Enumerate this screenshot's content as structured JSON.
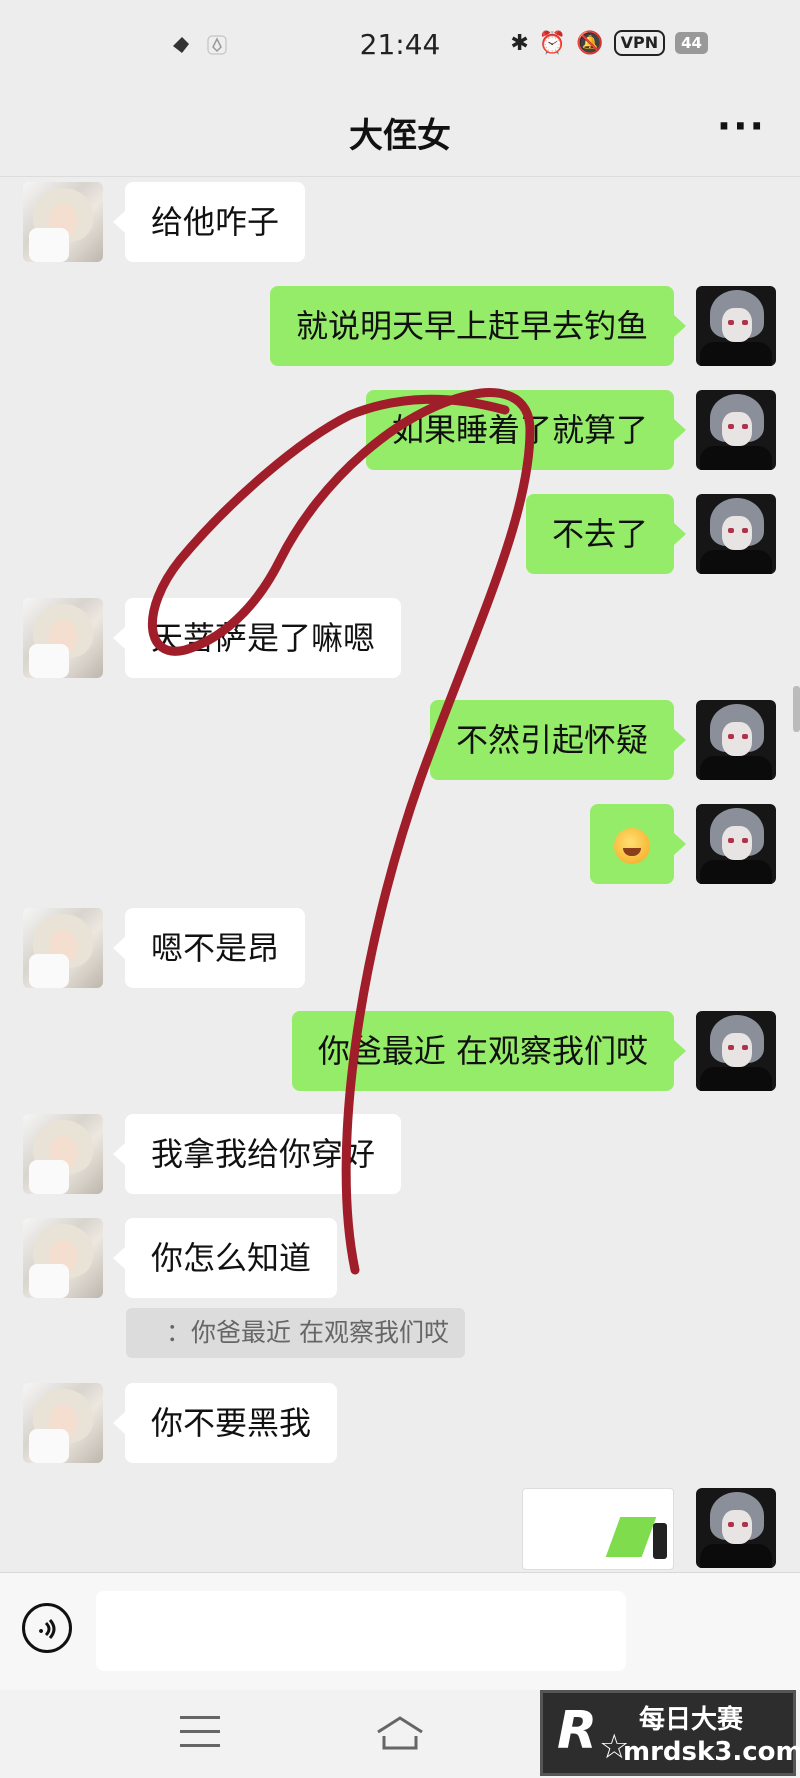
{
  "status_bar": {
    "time": "21:44",
    "vpn": "VPN",
    "battery": "44"
  },
  "header": {
    "title": "大侄女",
    "more": "···"
  },
  "messages": [
    {
      "side": "in",
      "text": "给他咋子"
    },
    {
      "side": "out",
      "text": "就说明天早上赶早去钓鱼"
    },
    {
      "side": "out",
      "text": "如果睡着了就算了"
    },
    {
      "side": "out",
      "text": "不去了"
    },
    {
      "side": "in",
      "text": "天菩萨是了嘛嗯"
    },
    {
      "side": "out",
      "text": "不然引起怀疑"
    },
    {
      "side": "out",
      "text": "",
      "emoji": "laughing-crying-emoji"
    },
    {
      "side": "in",
      "text": "嗯不是昂"
    },
    {
      "side": "out",
      "text": "你爸最近 在观察我们哎"
    },
    {
      "side": "in",
      "text": "我拿我给你穿好"
    },
    {
      "side": "in",
      "text": "你怎么知道",
      "quote": "：你爸最近 在观察我们哎"
    },
    {
      "side": "in",
      "text": "你不要黑我"
    },
    {
      "side": "out",
      "text": "",
      "image": true
    }
  ],
  "input": {
    "placeholder": ""
  },
  "watermark": {
    "logo": "R",
    "line1": "每日大赛",
    "line2": "mrdsk3.com"
  },
  "annotation_color": "#a01e2a"
}
